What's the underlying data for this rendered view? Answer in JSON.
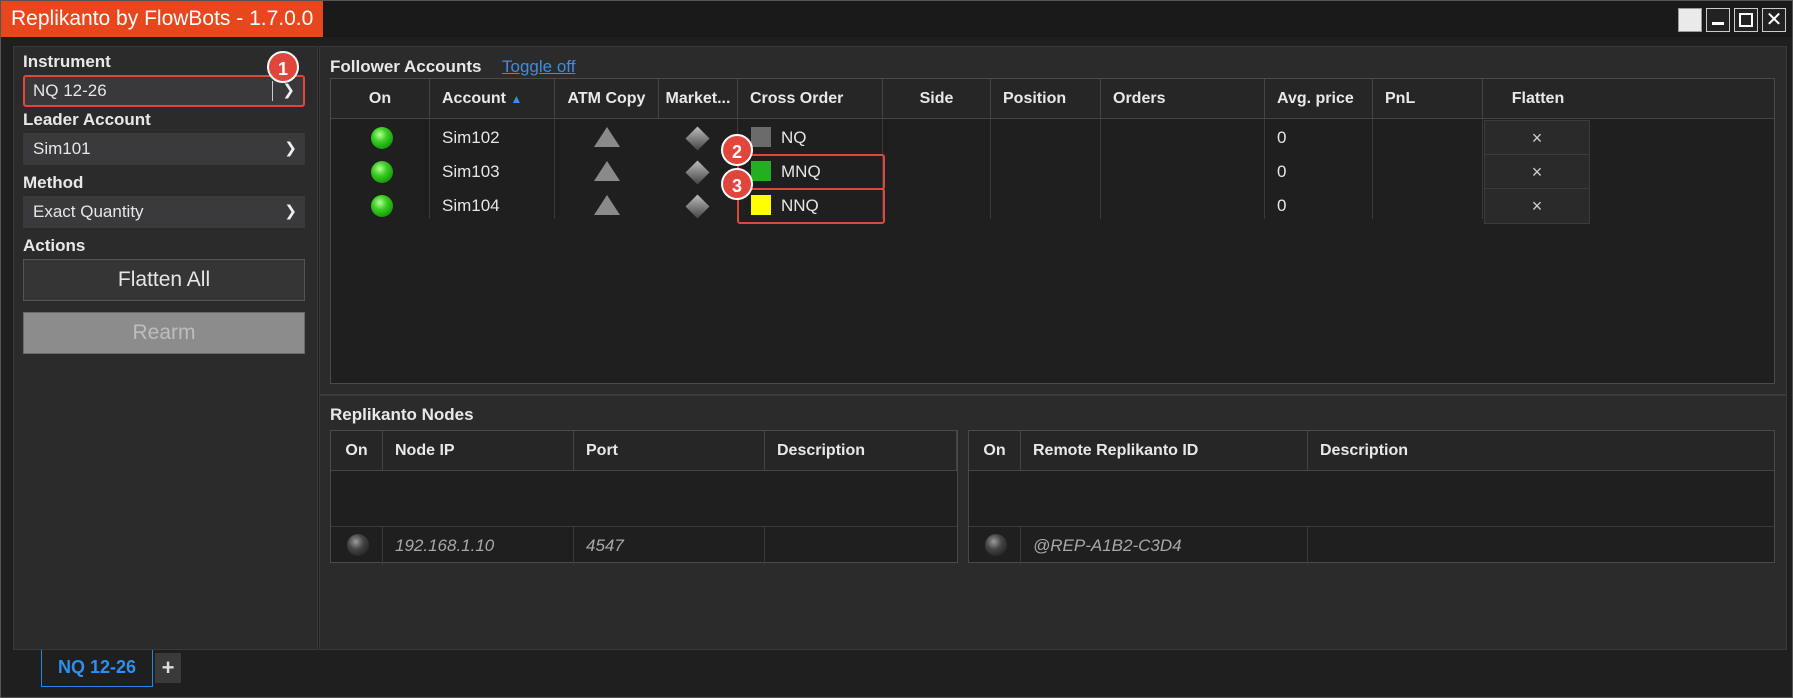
{
  "window": {
    "title": "Replikanto by FlowBots - 1.7.0.0"
  },
  "left_panel": {
    "instrument_label": "Instrument",
    "instrument_value": "NQ 12-26",
    "leader_label": "Leader Account",
    "leader_value": "Sim101",
    "method_label": "Method",
    "method_value": "Exact Quantity",
    "actions_label": "Actions",
    "flatten_all_label": "Flatten All",
    "rearm_label": "Rearm"
  },
  "badges": [
    "1",
    "2",
    "3"
  ],
  "followers": {
    "title": "Follower Accounts",
    "toggle_label": "Toggle off",
    "columns": [
      "On",
      "Account",
      "ATM Copy",
      "Market...",
      "Cross Order",
      "Side",
      "Position",
      "Orders",
      "Avg. price",
      "PnL",
      "Flatten"
    ],
    "rows": [
      {
        "account": "Sim102",
        "cross_order": "NQ",
        "swatch": "#6b6b6b",
        "avg_price": "0",
        "flatten": "×"
      },
      {
        "account": "Sim103",
        "cross_order": "MNQ",
        "swatch": "#22b022",
        "avg_price": "0",
        "flatten": "×"
      },
      {
        "account": "Sim104",
        "cross_order": "NNQ",
        "swatch": "#ffff00",
        "avg_price": "0",
        "flatten": "×"
      }
    ]
  },
  "nodes": {
    "title": "Replikanto Nodes",
    "left_columns": [
      "On",
      "Node IP",
      "Port",
      "Description"
    ],
    "left_row": {
      "ip": "192.168.1.10",
      "port": "4547"
    },
    "right_columns": [
      "On",
      "Remote Replikanto ID",
      "Description"
    ],
    "right_row": {
      "id": "@REP-A1B2-C3D4"
    }
  },
  "tabs": {
    "active": "NQ 12-26",
    "add": "+"
  },
  "colors": {
    "accent": "#e8461c",
    "highlight": "#e0463c",
    "link": "#3d8de0"
  }
}
